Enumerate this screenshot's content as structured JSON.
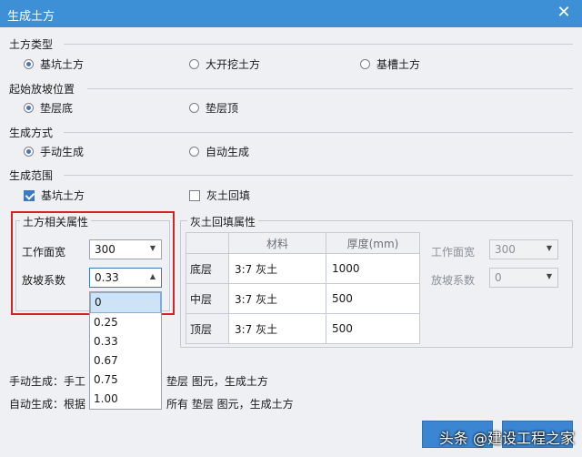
{
  "window": {
    "title": "生成土方"
  },
  "sections": {
    "type_label": "土方类型",
    "slope_start_label": "起始放坡位置",
    "method_label": "生成方式",
    "range_label": "生成范围"
  },
  "type_options": [
    "基坑土方",
    "大开挖土方",
    "基槽土方"
  ],
  "slope_options": [
    "垫层底",
    "垫层顶"
  ],
  "method_options": [
    "手动生成",
    "自动生成"
  ],
  "range_options": [
    "基坑土方",
    "灰土回填"
  ],
  "earth_props": {
    "title": "土方相关属性",
    "width_label": "工作面宽",
    "width_value": "300",
    "slope_label": "放坡系数",
    "slope_value": "0.33",
    "slope_options": [
      "0",
      "0.25",
      "0.33",
      "0.67",
      "0.75",
      "1.00"
    ]
  },
  "fill_props": {
    "title": "灰土回填属性",
    "headers": [
      "材料",
      "厚度(mm)"
    ],
    "rows": [
      {
        "name": "底层",
        "material": "3:7 灰土",
        "thickness": "1000"
      },
      {
        "name": "中层",
        "material": "3:7 灰土",
        "thickness": "500"
      },
      {
        "name": "顶层",
        "material": "3:7 灰土",
        "thickness": "500"
      }
    ],
    "width_label": "工作面宽",
    "width_value": "300",
    "slope_label": "放坡系数",
    "slope_value": "0"
  },
  "notes": {
    "manual_a": "手动生成：手工",
    "manual_b": "垫层 图元，生成土方",
    "auto_a": "自动生成：根据",
    "auto_b": "所有 垫层 图元，生成土方"
  },
  "watermark": "头条 @建设工程之家",
  "colors": {
    "accent": "#3d8fd6",
    "highlight": "#d32424"
  }
}
